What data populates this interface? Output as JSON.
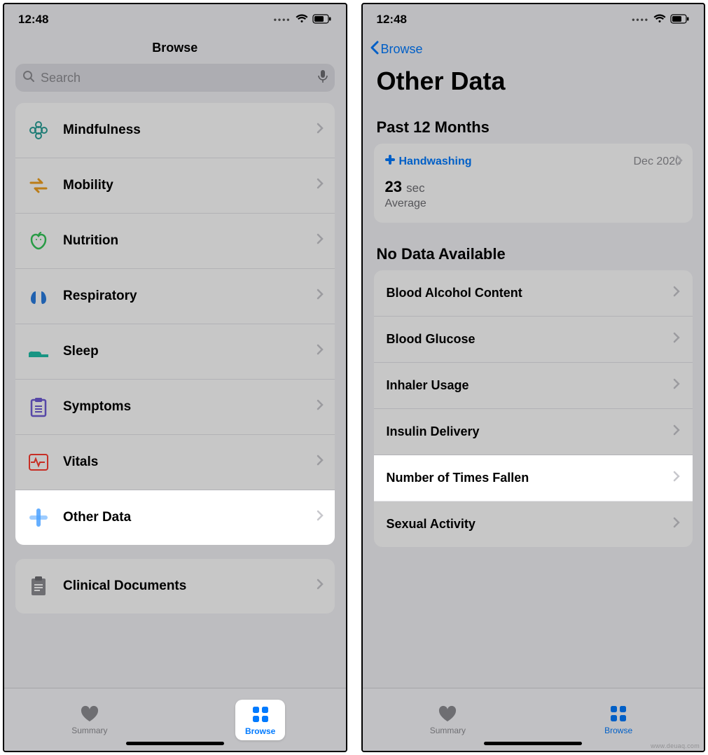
{
  "status": {
    "time": "12:48"
  },
  "left": {
    "nav_title": "Browse",
    "search_placeholder": "Search",
    "categories": [
      {
        "id": "mindfulness",
        "label": "Mindfulness",
        "color": "#2aa198"
      },
      {
        "id": "mobility",
        "label": "Mobility",
        "color": "#f0a020"
      },
      {
        "id": "nutrition",
        "label": "Nutrition",
        "color": "#34c759"
      },
      {
        "id": "respiratory",
        "label": "Respiratory",
        "color": "#2a7de1"
      },
      {
        "id": "sleep",
        "label": "Sleep",
        "color": "#1fbfa8"
      },
      {
        "id": "symptoms",
        "label": "Symptoms",
        "color": "#6f5bd6"
      },
      {
        "id": "vitals",
        "label": "Vitals",
        "color": "#ff3b30"
      },
      {
        "id": "other-data",
        "label": "Other Data",
        "color": "#4da3ff",
        "highlighted": true
      }
    ],
    "clinical": {
      "label": "Clinical Documents",
      "color": "#8e8e93"
    },
    "tabs": {
      "summary": "Summary",
      "browse": "Browse"
    }
  },
  "right": {
    "back_label": "Browse",
    "page_title": "Other Data",
    "section_past": "Past 12 Months",
    "handwashing": {
      "name": "Handwashing",
      "date": "Dec 2020",
      "value": "23",
      "unit": "sec",
      "avg_label": "Average"
    },
    "section_nodata": "No Data Available",
    "items": [
      {
        "id": "bac",
        "label": "Blood Alcohol Content"
      },
      {
        "id": "glucose",
        "label": "Blood Glucose"
      },
      {
        "id": "inhaler",
        "label": "Inhaler Usage"
      },
      {
        "id": "insulin",
        "label": "Insulin Delivery"
      },
      {
        "id": "falls",
        "label": "Number of Times Fallen",
        "highlighted": true
      },
      {
        "id": "sexual",
        "label": "Sexual Activity"
      }
    ],
    "tabs": {
      "summary": "Summary",
      "browse": "Browse"
    }
  },
  "watermark": "www.deuaq.com"
}
